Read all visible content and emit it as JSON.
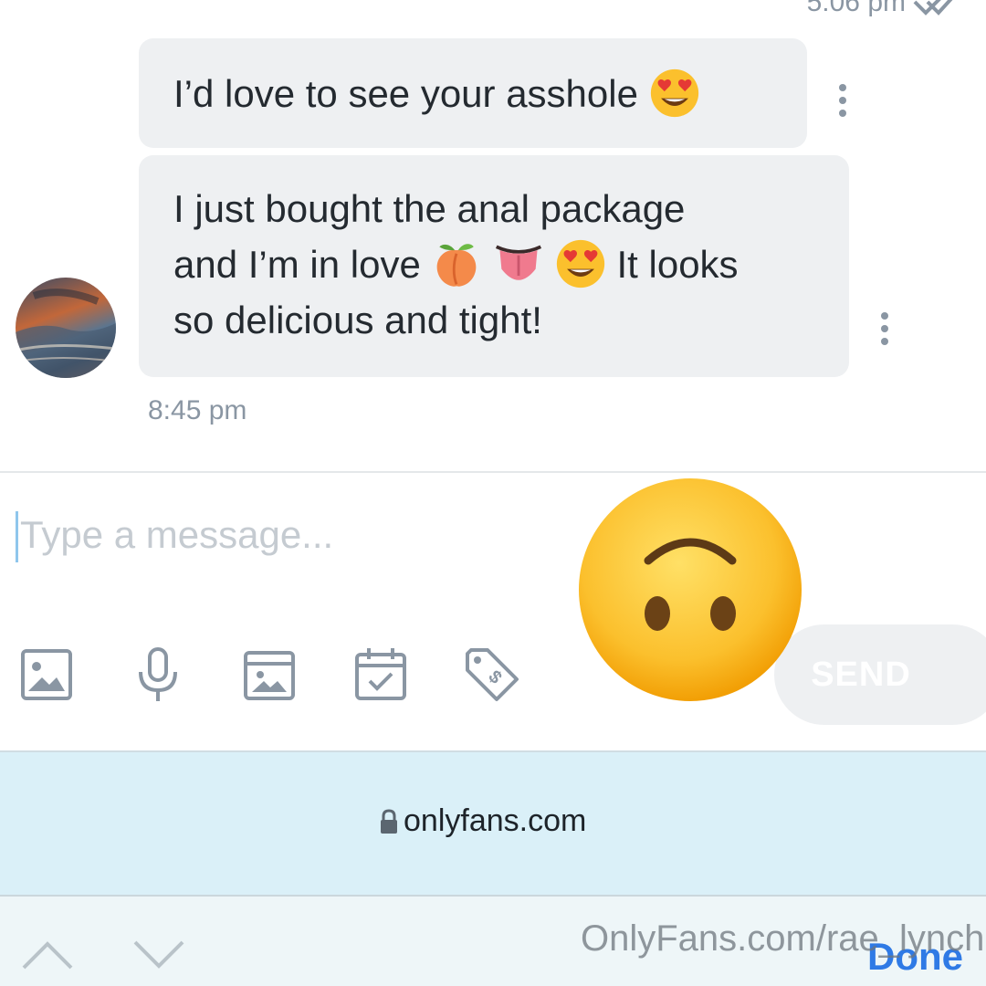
{
  "header": {
    "prev_time": "5:06 pm"
  },
  "messages": [
    {
      "lines": [
        {
          "text": "I’d love to see your asshole",
          "emojis_after": [
            "heart-eyes"
          ]
        }
      ]
    },
    {
      "lines": [
        {
          "text": "I just bought the anal package"
        },
        {
          "text_before": "and I’m in love",
          "emojis": [
            "peach",
            "tongue",
            "heart-eyes"
          ],
          "text_after": "It looks"
        },
        {
          "text": "so delicious and tight!"
        }
      ]
    }
  ],
  "message_time": "8:45 pm",
  "composer": {
    "placeholder": "Type a message...",
    "send_label": "SEND",
    "tools": [
      "image-icon",
      "microphone-icon",
      "vault-icon",
      "schedule-icon",
      "price-tag-icon"
    ]
  },
  "overlay_emoji": "upside-down-face",
  "browser": {
    "url": "onlyfans.com",
    "done_label": "Done"
  },
  "watermark": "OnlyFans.com/rae_lynch",
  "colors": {
    "accent": "#00aff0",
    "done": "#2f7ae5",
    "bubble": "#eef0f2",
    "muted": "#8a96a3",
    "url_bar": "#daf0f8"
  }
}
